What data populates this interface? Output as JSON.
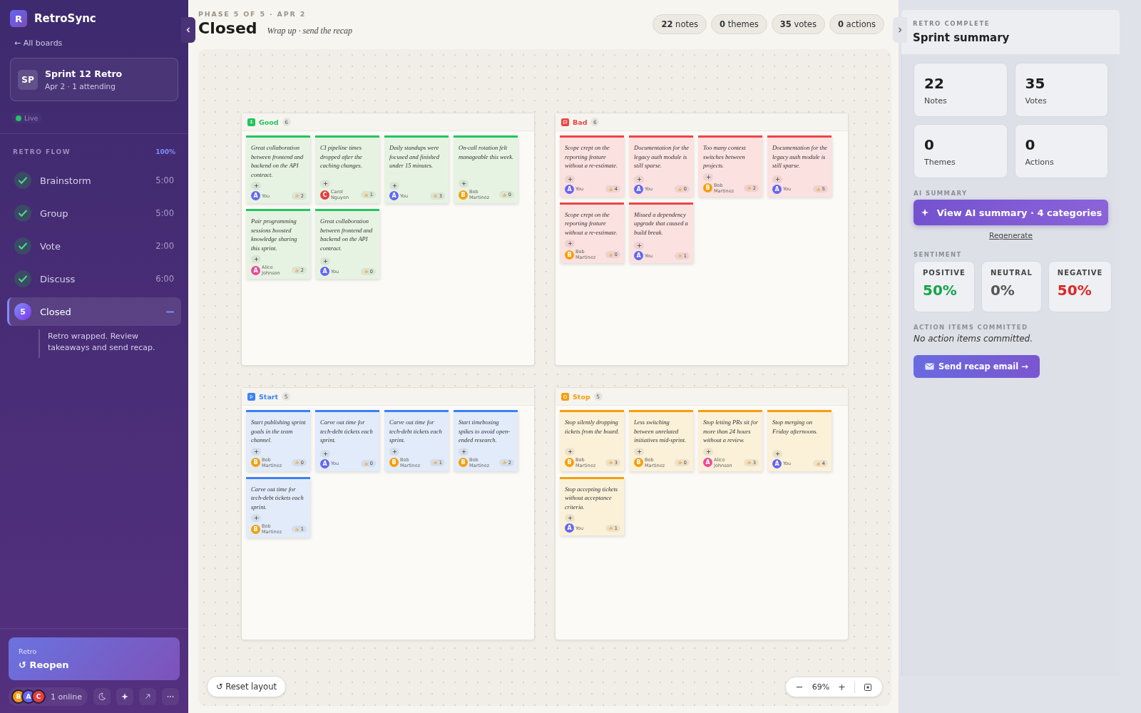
{
  "app": {
    "logo": "R",
    "name": "RetroSync",
    "back_link": "← All boards"
  },
  "board": {
    "initials": "SP",
    "title": "Sprint 12 Retro",
    "subtitle": "Apr 2 · 1 attending",
    "status": "Live"
  },
  "flow": {
    "title": "RETRO FLOW",
    "progress": "100%",
    "steps": [
      {
        "label": "Brainstorm",
        "time": "5:00",
        "done": true,
        "selected": false
      },
      {
        "label": "Group",
        "time": "5:00",
        "done": true,
        "selected": false
      },
      {
        "label": "Vote",
        "time": "2:00",
        "done": true,
        "selected": false
      },
      {
        "label": "Discuss",
        "time": "6:00",
        "done": true,
        "selected": false
      },
      {
        "label": "Closed",
        "badge": "5",
        "done": false,
        "selected": true,
        "expanded": true,
        "description": "Retro wrapped. Review takeaways and send recap."
      }
    ]
  },
  "footer": {
    "caption": "Retro",
    "action": "↺ Reopen",
    "avatars": [
      {
        "initial": "B",
        "color": "#f59e0b"
      },
      {
        "initial": "A",
        "color": "#6366f1"
      },
      {
        "initial": "C",
        "color": "#e53e3e"
      }
    ],
    "online": "1 online"
  },
  "header": {
    "phase": "PHASE 5 OF 5 · APR 2",
    "title": "Closed",
    "subtitle": "Wrap up · send the recap",
    "stats": [
      {
        "value": "22",
        "label": "notes"
      },
      {
        "value": "0",
        "label": "themes"
      },
      {
        "value": "35",
        "label": "votes"
      },
      {
        "value": "0",
        "label": "actions"
      }
    ]
  },
  "columns": [
    {
      "kind": "good",
      "title": "Good",
      "count": "6",
      "color": "#22c55e",
      "notes": [
        {
          "text": "Great collaboration between frontend and backend on the API contract.",
          "author": "You",
          "initial": "A",
          "color": "#6366f1",
          "votes": "2"
        },
        {
          "text": "CI pipeline times dropped after the caching changes.",
          "author": "Carol Nguyen",
          "initial": "C",
          "color": "#e53e3e",
          "votes": "1"
        },
        {
          "text": "Daily standups were focused and finished under 15 minutes.",
          "author": "You",
          "initial": "A",
          "color": "#6366f1",
          "votes": "3"
        },
        {
          "text": "On-call rotation felt manageable this week.",
          "author": "Bob Martinez",
          "initial": "B",
          "color": "#f59e0b",
          "votes": "0"
        },
        {
          "text": "Pair programming sessions boosted knowledge sharing this sprint.",
          "author": "Alice Johnson",
          "initial": "A",
          "color": "#ec4899",
          "votes": "2"
        },
        {
          "text": "Great collaboration between frontend and backend on the API contract.",
          "author": "You",
          "initial": "A",
          "color": "#6366f1",
          "votes": "0"
        }
      ]
    },
    {
      "kind": "bad",
      "title": "Bad",
      "count": "6",
      "color": "#ef4444",
      "notes": [
        {
          "text": "Scope crept on the reporting feature without a re-estimate.",
          "author": "You",
          "initial": "A",
          "color": "#6366f1",
          "votes": "4"
        },
        {
          "text": "Documentation for the legacy auth module is still sparse.",
          "author": "You",
          "initial": "A",
          "color": "#6366f1",
          "votes": "0"
        },
        {
          "text": "Too many context switches between projects.",
          "author": "Bob Martinez",
          "initial": "B",
          "color": "#f59e0b",
          "votes": "2"
        },
        {
          "text": "Documentation for the legacy auth module is still sparse.",
          "author": "You",
          "initial": "A",
          "color": "#6366f1",
          "votes": "5"
        },
        {
          "text": "Scope crept on the reporting feature without a re-estimate.",
          "author": "Bob Martinez",
          "initial": "B",
          "color": "#f59e0b",
          "votes": "0"
        },
        {
          "text": "Missed a dependency upgrade that caused a build break.",
          "author": "You",
          "initial": "A",
          "color": "#6366f1",
          "votes": "1"
        }
      ]
    },
    {
      "kind": "start",
      "title": "Start",
      "count": "5",
      "color": "#3b82f6",
      "notes": [
        {
          "text": "Start publishing sprint goals in the team channel.",
          "author": "Bob Martinez",
          "initial": "B",
          "color": "#f59e0b",
          "votes": "0"
        },
        {
          "text": "Carve out time for tech-debt tickets each sprint.",
          "author": "You",
          "initial": "A",
          "color": "#6366f1",
          "votes": "0"
        },
        {
          "text": "Carve out time for tech-debt tickets each sprint.",
          "author": "Bob Martinez",
          "initial": "B",
          "color": "#f59e0b",
          "votes": "1"
        },
        {
          "text": "Start timeboxing spikes to avoid open-ended research.",
          "author": "Bob Martinez",
          "initial": "B",
          "color": "#f59e0b",
          "votes": "2"
        },
        {
          "text": "Carve out time for tech-debt tickets each sprint.",
          "author": "Bob Martinez",
          "initial": "B",
          "color": "#f59e0b",
          "votes": "1"
        }
      ]
    },
    {
      "kind": "stop",
      "title": "Stop",
      "count": "5",
      "color": "#f59e0b",
      "notes": [
        {
          "text": "Stop silently dropping tickets from the board.",
          "author": "Bob Martinez",
          "initial": "B",
          "color": "#f59e0b",
          "votes": "3"
        },
        {
          "text": "Less switching between unrelated initiatives mid-sprint.",
          "author": "Bob Martinez",
          "initial": "B",
          "color": "#f59e0b",
          "votes": "0"
        },
        {
          "text": "Stop letting PRs sit for more than 24 hours without a review.",
          "author": "Alice Johnson",
          "initial": "A",
          "color": "#ec4899",
          "votes": "3"
        },
        {
          "text": "Stop merging on Friday afternoons.",
          "author": "You",
          "initial": "A",
          "color": "#6366f1",
          "votes": "4"
        },
        {
          "text": "Stop accepting tickets without acceptance criteria.",
          "author": "You",
          "initial": "A",
          "color": "#6366f1",
          "votes": "1"
        }
      ]
    }
  ],
  "canvas": {
    "reset": "↺ Reset layout",
    "zoom_out": "−",
    "zoom": "69%",
    "zoom_in": "+"
  },
  "summary": {
    "eyebrow": "RETRO COMPLETE",
    "title": "Sprint summary",
    "stats": [
      {
        "value": "22",
        "label": "Notes"
      },
      {
        "value": "35",
        "label": "Votes"
      },
      {
        "value": "0",
        "label": "Themes"
      },
      {
        "value": "0",
        "label": "Actions"
      }
    ],
    "ai_heading": "AI SUMMARY",
    "ai_button": "View AI summary · 4 categories",
    "regenerate": "Regenerate",
    "sentiment_heading": "SENTIMENT",
    "sentiment": [
      {
        "kind": "positive",
        "label": "POSITIVE",
        "value": "50%"
      },
      {
        "kind": "neutral",
        "label": "NEUTRAL",
        "value": "0%"
      },
      {
        "kind": "negative",
        "label": "NEGATIVE",
        "value": "50%"
      }
    ],
    "actions_heading": "ACTION ITEMS COMMITTED",
    "actions_empty": "No action items committed.",
    "send_button": "Send recap email →"
  }
}
